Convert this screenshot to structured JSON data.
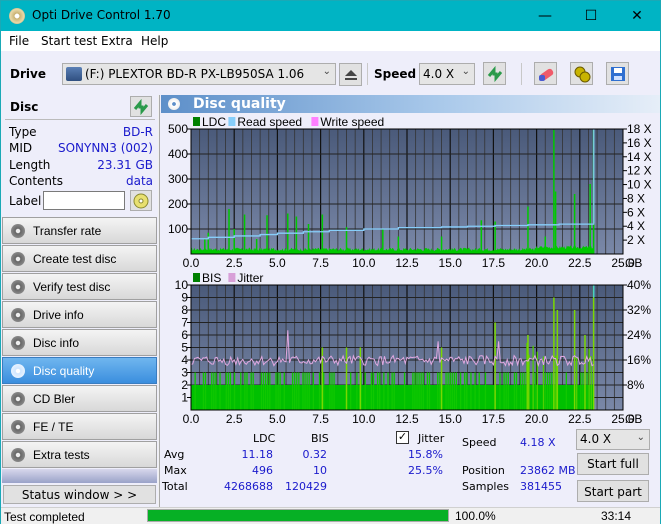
{
  "window": {
    "title": "Opti Drive Control 1.70",
    "minimize": "—",
    "maximize": "☐",
    "close": "✕"
  },
  "menu": [
    "File",
    "Start test",
    "Extra",
    "Help"
  ],
  "toolbar": {
    "drive_label": "Drive",
    "drive_value": "(F:)  PLEXTOR BD-R  PX-LB950SA 1.06",
    "speed_label": "Speed",
    "speed_value": "4.0 X"
  },
  "disc": {
    "header": "Disc",
    "rows": [
      {
        "key": "Type",
        "value": "BD-R"
      },
      {
        "key": "MID",
        "value": "SONYNN3 (002)"
      },
      {
        "key": "Length",
        "value": "23.31 GB"
      },
      {
        "key": "Contents",
        "value": "data"
      }
    ],
    "label_key": "Label",
    "label_value": ""
  },
  "nav": [
    {
      "label": "Transfer rate",
      "active": false
    },
    {
      "label": "Create test disc",
      "active": false
    },
    {
      "label": "Verify test disc",
      "active": false
    },
    {
      "label": "Drive info",
      "active": false
    },
    {
      "label": "Disc info",
      "active": false
    },
    {
      "label": "Disc quality",
      "active": true
    },
    {
      "label": "CD Bler",
      "active": false
    },
    {
      "label": "FE / TE",
      "active": false
    },
    {
      "label": "Extra tests",
      "active": false
    }
  ],
  "status_window_button": "Status window > >",
  "panel_title": "Disc quality",
  "stats": {
    "col_ldc": "LDC",
    "col_bis": "BIS",
    "jitter_label": "Jitter",
    "jitter_checked": true,
    "rows": [
      {
        "label": "Avg",
        "ldc": "11.18",
        "bis": "0.32",
        "jitter": "15.8%"
      },
      {
        "label": "Max",
        "ldc": "496",
        "bis": "10",
        "jitter": "25.5%"
      },
      {
        "label": "Total",
        "ldc": "4268688",
        "bis": "120429",
        "jitter": ""
      }
    ],
    "speed_label": "Speed",
    "speed_value": "4.18 X",
    "position_label": "Position",
    "position_value": "23862 MB",
    "samples_label": "Samples",
    "samples_value": "381455",
    "speed_select": "4.0 X",
    "start_full": "Start full",
    "start_part": "Start part"
  },
  "statusbar": {
    "text": "Test completed",
    "progress": 100.0,
    "progress_text": "100.0%",
    "time": "33:14"
  },
  "chart_data": [
    {
      "type": "bar",
      "title": "LDC / Read speed",
      "legend": [
        "LDC",
        "Read speed",
        "Write speed"
      ],
      "legend_colors": [
        "#008000",
        "#87cefa",
        "#ff80ff"
      ],
      "xlabel": "GB",
      "xlim": [
        0,
        25
      ],
      "xticks": [
        "0.0",
        "2.5",
        "5.0",
        "7.5",
        "10.0",
        "12.5",
        "15.0",
        "17.5",
        "20.0",
        "22.5",
        "25.0"
      ],
      "ylim": [
        0,
        500
      ],
      "yticks_left": [
        "100",
        "200",
        "300",
        "400",
        "500"
      ],
      "y2lim": [
        0,
        18
      ],
      "yticks_right": [
        "2 X",
        "4 X",
        "6 X",
        "8 X",
        "10 X",
        "12 X",
        "14 X",
        "16 X",
        "18 X"
      ],
      "ldc_peaks": [
        {
          "x": 0.8,
          "y": 60
        },
        {
          "x": 1.0,
          "y": 85
        },
        {
          "x": 2.2,
          "y": 180
        },
        {
          "x": 2.5,
          "y": 100
        },
        {
          "x": 3.1,
          "y": 158
        },
        {
          "x": 3.8,
          "y": 60
        },
        {
          "x": 4.4,
          "y": 155
        },
        {
          "x": 5.6,
          "y": 162
        },
        {
          "x": 6.1,
          "y": 150
        },
        {
          "x": 6.8,
          "y": 120
        },
        {
          "x": 7.6,
          "y": 158
        },
        {
          "x": 9.0,
          "y": 108
        },
        {
          "x": 11.1,
          "y": 100
        },
        {
          "x": 12.0,
          "y": 70
        },
        {
          "x": 14.5,
          "y": 70
        },
        {
          "x": 16.8,
          "y": 135
        },
        {
          "x": 17.6,
          "y": 130
        },
        {
          "x": 19.5,
          "y": 190
        },
        {
          "x": 20.5,
          "y": 70
        },
        {
          "x": 21.0,
          "y": 496
        },
        {
          "x": 21.1,
          "y": 250
        },
        {
          "x": 22.2,
          "y": 240
        },
        {
          "x": 23.1,
          "y": 280
        },
        {
          "x": 23.3,
          "y": 496
        }
      ],
      "ldc_baseline": 12,
      "read_speed": [
        {
          "x": 0.0,
          "y": 2.2
        },
        {
          "x": 1.0,
          "y": 2.4
        },
        {
          "x": 2.5,
          "y": 2.6
        },
        {
          "x": 4.0,
          "y": 2.8
        },
        {
          "x": 5.0,
          "y": 3.0
        },
        {
          "x": 6.5,
          "y": 3.2
        },
        {
          "x": 8.0,
          "y": 3.4
        },
        {
          "x": 10.0,
          "y": 3.6
        },
        {
          "x": 12.0,
          "y": 3.8
        },
        {
          "x": 14.5,
          "y": 3.9
        },
        {
          "x": 16.0,
          "y": 4.0
        },
        {
          "x": 17.6,
          "y": 4.1
        },
        {
          "x": 19.5,
          "y": 4.2
        },
        {
          "x": 21.3,
          "y": 4.3
        },
        {
          "x": 23.3,
          "y": 4.4
        }
      ]
    },
    {
      "type": "bar",
      "title": "BIS / Jitter",
      "legend": [
        "BIS",
        "Jitter"
      ],
      "legend_colors": [
        "#008000",
        "#d8a0d8"
      ],
      "xlabel": "GB",
      "xlim": [
        0,
        25
      ],
      "xticks": [
        "0.0",
        "2.5",
        "5.0",
        "7.5",
        "10.0",
        "12.5",
        "15.0",
        "17.5",
        "20.0",
        "22.5",
        "25.0"
      ],
      "ylim": [
        0,
        10
      ],
      "yticks_left": [
        "1",
        "2",
        "3",
        "4",
        "5",
        "6",
        "7",
        "8",
        "9",
        "10"
      ],
      "y2lim": [
        0,
        40
      ],
      "yticks_right": [
        "8%",
        "16%",
        "24%",
        "32%",
        "40%"
      ],
      "bis_baseline": 2,
      "bis_peaks": [
        {
          "x": 7.6,
          "y": 5
        },
        {
          "x": 9.0,
          "y": 5
        },
        {
          "x": 9.8,
          "y": 5
        },
        {
          "x": 14.5,
          "y": 5
        },
        {
          "x": 17.6,
          "y": 7
        },
        {
          "x": 19.5,
          "y": 6
        },
        {
          "x": 21.0,
          "y": 9
        },
        {
          "x": 21.2,
          "y": 8
        },
        {
          "x": 22.2,
          "y": 8
        },
        {
          "x": 22.8,
          "y": 6
        },
        {
          "x": 23.3,
          "y": 10
        }
      ],
      "jitter_avg_pct": 15.8,
      "jitter_peaks": [
        {
          "x": 5.6,
          "y": 25.5
        },
        {
          "x": 14.3,
          "y": 22
        },
        {
          "x": 17.8,
          "y": 22
        }
      ]
    }
  ]
}
